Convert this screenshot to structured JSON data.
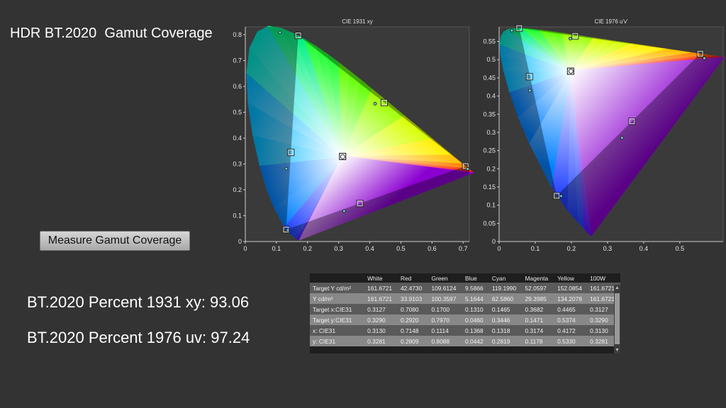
{
  "page": {
    "title": "HDR BT.2020  Gamut Coverage",
    "measure_button": "Measure Gamut Coverage",
    "result_1931": "BT.2020 Percent 1931 xy: 93.06",
    "result_1976": "BT.2020 Percent 1976 uv: 97.24"
  },
  "chart_data": [
    {
      "type": "scatter",
      "title": "CIE 1931 xy",
      "xlim": [
        0,
        0.72
      ],
      "ylim": [
        0,
        0.83
      ],
      "x_ticks": [
        "0",
        "0.1",
        "0.2",
        "0.3",
        "0.4",
        "0.5",
        "0.6",
        "0.7"
      ],
      "y_ticks": [
        "0",
        "0.1",
        "0.2",
        "0.3",
        "0.4",
        "0.5",
        "0.6",
        "0.7",
        "0.8"
      ],
      "grid": false,
      "target_gamut": {
        "x": [
          0.708,
          0.17,
          0.131
        ],
        "y": [
          0.292,
          0.797,
          0.046
        ]
      },
      "series": [
        {
          "values": [
            {
              "x": 0.3127,
              "y": 0.329
            },
            {
              "x": 0.708,
              "y": 0.292
            },
            {
              "x": 0.17,
              "y": 0.797
            },
            {
              "x": 0.131,
              "y": 0.046
            },
            {
              "x": 0.1465,
              "y": 0.3446
            },
            {
              "x": 0.3682,
              "y": 0.1471
            },
            {
              "x": 0.4465,
              "y": 0.5374
            }
          ]
        },
        {
          "values": [
            {
              "x": 0.313,
              "y": 0.3281
            },
            {
              "x": 0.7148,
              "y": 0.2809
            },
            {
              "x": 0.1114,
              "y": 0.8088
            },
            {
              "x": 0.1368,
              "y": 0.0442
            },
            {
              "x": 0.1318,
              "y": 0.2819
            },
            {
              "x": 0.3174,
              "y": 0.1178
            },
            {
              "x": 0.4172,
              "y": 0.533
            }
          ]
        }
      ]
    },
    {
      "type": "scatter",
      "title": "CIE 1976 u'v'",
      "xlim": [
        0,
        0.62
      ],
      "ylim": [
        0,
        0.59
      ],
      "x_ticks": [
        "0",
        "0.1",
        "0.2",
        "0.3",
        "0.4",
        "0.5"
      ],
      "y_ticks": [
        "0",
        "0.05",
        "0.1",
        "0.15",
        "0.2",
        "0.25",
        "0.3",
        "0.35",
        "0.4",
        "0.45",
        "0.5",
        "0.55"
      ],
      "grid": false,
      "target_gamut": {
        "u": [
          0.5566,
          0.0556,
          0.1593
        ],
        "v": [
          0.5165,
          0.5868,
          0.1258
        ]
      },
      "series": [
        {
          "values": [
            {
              "x": 0.1978,
              "y": 0.4683
            },
            {
              "x": 0.5566,
              "y": 0.5165
            },
            {
              "x": 0.0556,
              "y": 0.5868
            },
            {
              "x": 0.1593,
              "y": 0.1258
            },
            {
              "x": 0.0839,
              "y": 0.4531
            },
            {
              "x": 0.3678,
              "y": 0.3305
            },
            {
              "x": 0.2106,
              "y": 0.5653
            }
          ]
        },
        {
          "values": [
            {
              "x": 0.1986,
              "y": 0.4684
            },
            {
              "x": 0.568,
              "y": 0.504
            },
            {
              "x": 0.035,
              "y": 0.58
            },
            {
              "x": 0.1715,
              "y": 0.125
            },
            {
              "x": 0.085,
              "y": 0.415
            },
            {
              "x": 0.34,
              "y": 0.285
            },
            {
              "x": 0.197,
              "y": 0.558
            }
          ]
        }
      ]
    }
  ],
  "table": {
    "columns": [
      "",
      "White",
      "Red",
      "Green",
      "Blue",
      "Cyan",
      "Magenta",
      "Yellow",
      "100W"
    ],
    "rows": [
      [
        "Target Y cd/m²",
        "161.6721",
        "42.4730",
        "109.6124",
        "9.5866",
        "119.1990",
        "52.0597",
        "152.0854",
        "161.6721"
      ],
      [
        "Y cd/m²",
        "161.6721",
        "33.9103",
        "100.3597",
        "5.1644",
        "62.5860",
        "29.3985",
        "134.2078",
        "161.6721"
      ],
      [
        "Target x:CIE31",
        "0.3127",
        "0.7080",
        "0.1700",
        "0.1310",
        "0.1465",
        "0.3682",
        "0.4465",
        "0.3127"
      ],
      [
        "Target y:CIE31",
        "0.3290",
        "0.2920",
        "0.7970",
        "0.0460",
        "0.3446",
        "0.1471",
        "0.5374",
        "0.3290"
      ],
      [
        "x: CIE31",
        "0.3130",
        "0.7148",
        "0.1114",
        "0.1368",
        "0.1318",
        "0.3174",
        "0.4172",
        "0.3130"
      ],
      [
        "y: CIE31",
        "0.3281",
        "0.2809",
        "0.8088",
        "0.0442",
        "0.2819",
        "0.1178",
        "0.5330",
        "0.3281"
      ]
    ]
  },
  "colors": {
    "background": "#333333",
    "plot_background": "#3a3a3a",
    "axis": "#cfcfcf"
  }
}
